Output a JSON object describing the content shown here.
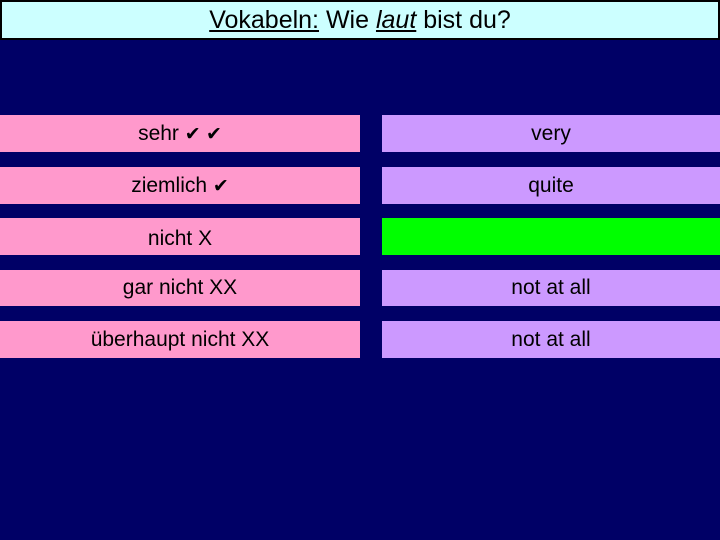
{
  "header": {
    "title_part1": "Vokabeln:",
    "title_part2": " Wie ",
    "title_part3": "laut",
    "title_part4": " bist du?"
  },
  "rows": [
    {
      "german": "sehr",
      "checks": "✔ ✔",
      "english": "very",
      "english_state": "shown"
    },
    {
      "german": "ziemlich",
      "checks": "✔",
      "english": "quite",
      "english_state": "shown"
    },
    {
      "german": "nicht X",
      "checks": "",
      "english": "",
      "english_state": "hidden-green"
    },
    {
      "german": "gar nicht XX",
      "checks": "",
      "english": "not at all",
      "english_state": "shown"
    },
    {
      "german": "überhaupt nicht XX",
      "checks": "",
      "english": "not at all",
      "english_state": "shown"
    }
  ],
  "colors": {
    "background": "#000066",
    "header": "#ccffff",
    "german_box": "#ff99cc",
    "english_box": "#cc99ff",
    "hidden_box": "#00ff00"
  }
}
